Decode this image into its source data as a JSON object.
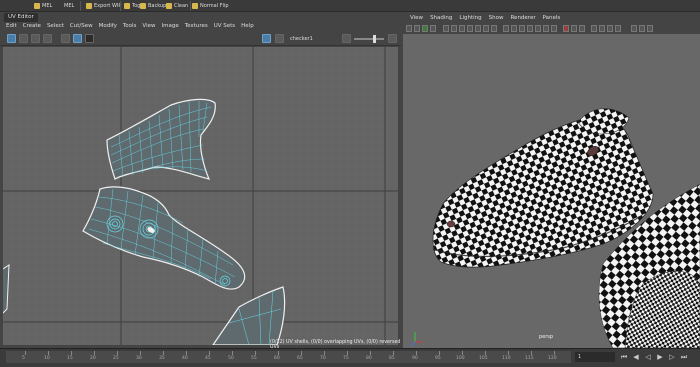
{
  "shelf": {
    "items": [
      {
        "label": "MEL",
        "icon": "script-icon"
      },
      {
        "label": "MEL",
        "icon": "mel-icon"
      },
      {
        "label": "Export WIP",
        "icon": "export-icon"
      },
      {
        "label": "Tog",
        "icon": "toggle-icon"
      },
      {
        "label": "Backup",
        "icon": "backup-icon"
      },
      {
        "label": "Clean",
        "icon": "clean-icon"
      },
      {
        "label": "Normal Flip",
        "icon": "normal-flip-icon"
      }
    ]
  },
  "uv_editor": {
    "title": "UV Editor",
    "menu": [
      "Edit",
      "Create",
      "Select",
      "Cut/Sew",
      "Modify",
      "Tools",
      "View",
      "Image",
      "Textures",
      "UV Sets",
      "Help"
    ],
    "texture_field": "checker1",
    "status": "(0/12) UV shells, (0/0) overlapping UVs, (0/0) reversed UVs"
  },
  "perspective": {
    "menu": [
      "View",
      "Shading",
      "Lighting",
      "Show",
      "Renderer",
      "Panels"
    ],
    "camera_label": "persp",
    "axis": {
      "x_color": "#d23c3c",
      "y_color": "#3cc83c",
      "z_color": "#3c78dc"
    }
  },
  "timeline": {
    "ticks": [
      "5",
      "10",
      "15",
      "20",
      "25",
      "30",
      "35",
      "40",
      "45",
      "50",
      "55",
      "60",
      "65",
      "70",
      "75",
      "80",
      "85",
      "90",
      "95",
      "100",
      "105",
      "110",
      "115",
      "120"
    ],
    "current_frame": "1",
    "buttons": [
      "go-start-icon",
      "step-back-icon",
      "play-back-icon",
      "play-forward-icon",
      "step-forward-icon",
      "go-end-icon"
    ]
  },
  "colors": {
    "uv_wire": "#68d8e8",
    "uv_border": "#f0f0f0",
    "accent": "#4a7da8"
  }
}
